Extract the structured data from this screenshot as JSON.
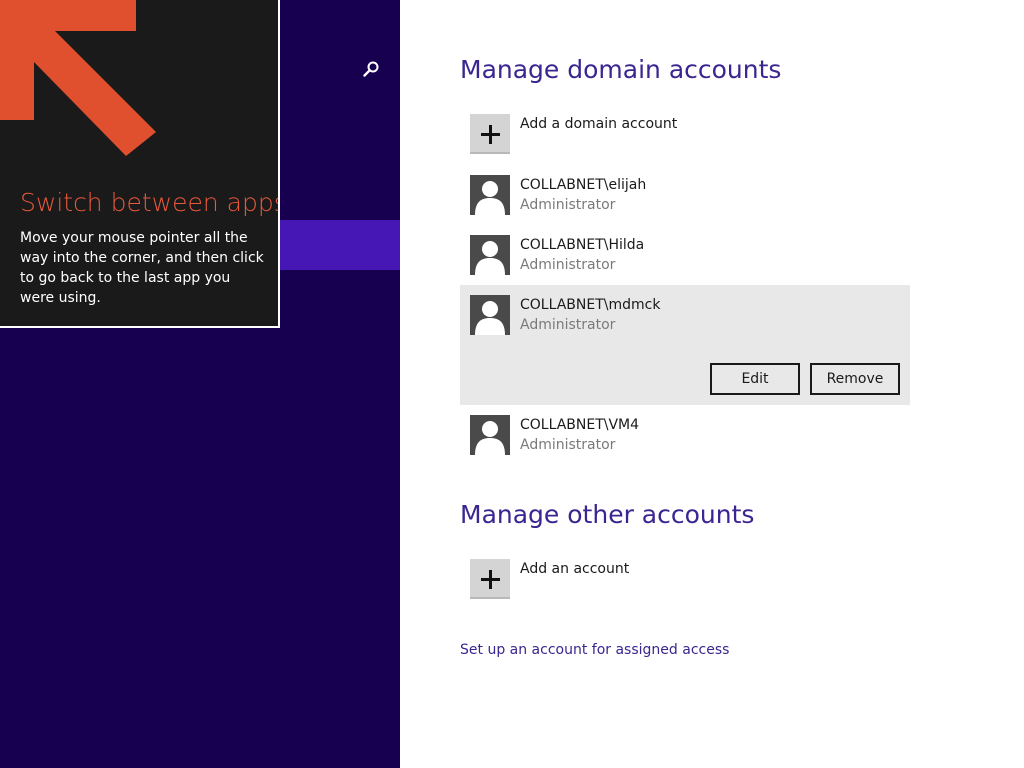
{
  "tip": {
    "title": "Switch between apps",
    "body": "Move your mouse pointer all the way into the corner, and then click to go back to the last app you were using."
  },
  "domain_section": {
    "title": "Manage domain accounts",
    "add_label": "Add a domain account",
    "accounts": [
      {
        "name": "COLLABNET\\elijah",
        "role": "Administrator"
      },
      {
        "name": "COLLABNET\\Hilda",
        "role": "Administrator"
      },
      {
        "name": "COLLABNET\\mdmck",
        "role": "Administrator"
      },
      {
        "name": "COLLABNET\\VM4",
        "role": "Administrator"
      }
    ],
    "edit_label": "Edit",
    "remove_label": "Remove"
  },
  "other_section": {
    "title": "Manage other accounts",
    "add_label": "Add an account"
  },
  "assigned_access_link": "Set up an account for assigned access",
  "icons": {
    "search": "search-icon",
    "add": "plus-icon",
    "user": "user-avatar-icon",
    "corner": "corner-arrow-icon"
  },
  "colors": {
    "accent": "#3b2590",
    "left_background": "#180050",
    "selected_band": "#4617b4",
    "tip_title": "#e8583a",
    "tip_arrow": "#e0502e"
  }
}
